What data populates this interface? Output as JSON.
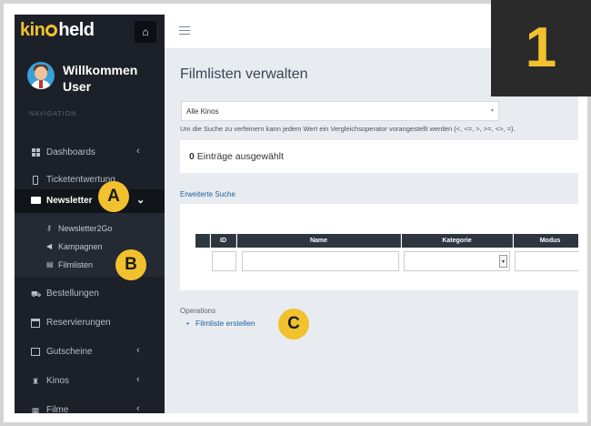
{
  "brand": {
    "part1": "kin",
    "part2": "held"
  },
  "user": {
    "line1": "Willkommen",
    "line2": "User"
  },
  "sidebar": {
    "nav_heading": "NAVIGATION",
    "items": [
      {
        "label": "Dashboards",
        "icon": "dashboard-icon",
        "chevron": "‹"
      },
      {
        "label": "Ticketentwertung",
        "icon": "phone-icon",
        "chevron": ""
      },
      {
        "label": "Newsletter",
        "icon": "envelope-icon",
        "chevron": "⌄"
      },
      {
        "label": "Bestellungen",
        "icon": "cart-icon",
        "chevron": ""
      },
      {
        "label": "Reservierungen",
        "icon": "calendar-icon",
        "chevron": ""
      },
      {
        "label": "Gutscheine",
        "icon": "gift-icon",
        "chevron": "‹"
      },
      {
        "label": "Kinos",
        "icon": "seats-icon",
        "chevron": "‹"
      },
      {
        "label": "Filme",
        "icon": "film-icon",
        "chevron": "‹"
      }
    ],
    "sub_items": [
      {
        "label": "Newsletter2Go",
        "icon": "key-icon"
      },
      {
        "label": "Kampagnen",
        "icon": "megaphone-icon"
      },
      {
        "label": "Filmlisten",
        "icon": "list-icon"
      }
    ]
  },
  "main": {
    "title": "Filmlisten verwalten",
    "select_value": "Alle Kinos",
    "hint": "Um die Suche zu verfeinern kann jedem Wert ein Vergleichsoperator vorangestellt werden (<, <=, >, >=, <>, =).",
    "selected_count": "0",
    "selected_text": "Einträge ausgewählt",
    "advanced_search": "Erweiterte Suche",
    "table_headers": [
      "ID",
      "Name",
      "Kategorie",
      "Modus"
    ],
    "operations_heading": "Operations",
    "operations": [
      "Filmliste erstellen"
    ]
  },
  "overlays": {
    "step": "1",
    "markers": [
      "A",
      "B",
      "C"
    ]
  },
  "colors": {
    "sidebar": "#1c2129",
    "accent": "#f2c12e",
    "link": "#1f5f9c",
    "content_bg": "#e8ecf1"
  }
}
